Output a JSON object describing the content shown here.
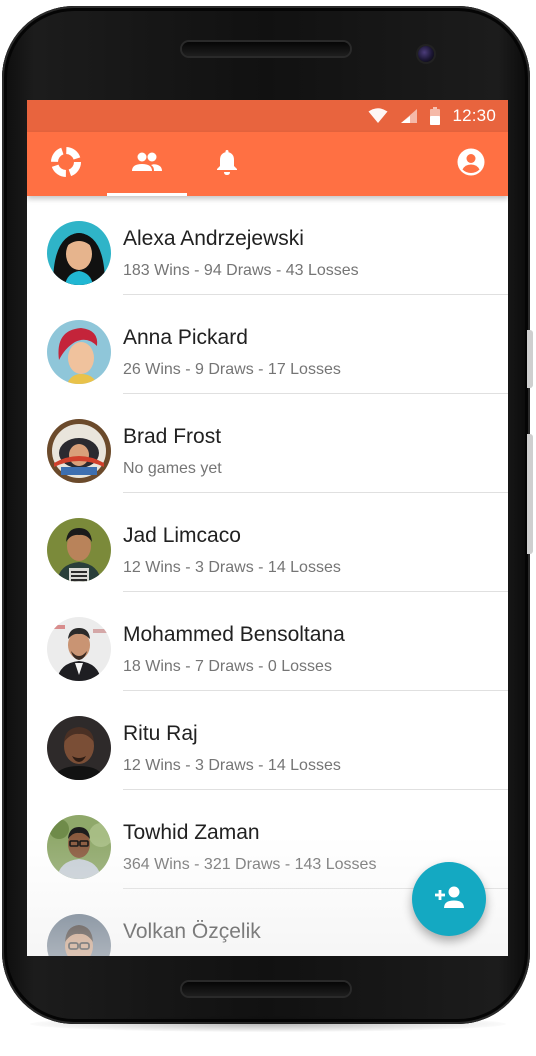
{
  "status_bar": {
    "time": "12:30",
    "icons": [
      "wifi-icon",
      "cell-signal-icon",
      "battery-icon"
    ]
  },
  "app_bar": {
    "tabs": [
      {
        "icon": "app-logo-icon"
      },
      {
        "icon": "friends-icon",
        "selected": true
      },
      {
        "icon": "notifications-bell-icon"
      }
    ],
    "account_icon": "account-circle-icon"
  },
  "friends": [
    {
      "name": "Alexa Andrzejewski",
      "record": "183 Wins - 94 Draws - 43 Losses"
    },
    {
      "name": "Anna Pickard",
      "record": "26 Wins - 9 Draws - 17 Losses"
    },
    {
      "name": "Brad Frost",
      "record": "No games yet"
    },
    {
      "name": "Jad Limcaco",
      "record": "12 Wins - 3 Draws - 14 Losses"
    },
    {
      "name": "Mohammed Bensoltana",
      "record": "18 Wins - 7 Draws - 0 Losses"
    },
    {
      "name": "Ritu Raj",
      "record": "12 Wins - 3 Draws - 14 Losses"
    },
    {
      "name": "Towhid Zaman",
      "record": "364 Wins - 321 Draws - 143 Losses"
    },
    {
      "name": "Volkan Özçelik",
      "record": ""
    }
  ],
  "fab": {
    "icon": "add-person-icon"
  },
  "colors": {
    "status_bar": "#e8643e",
    "app_bar": "#ff7043",
    "fab": "#14a9c2",
    "name_text": "#212121",
    "record_text": "#757575"
  }
}
